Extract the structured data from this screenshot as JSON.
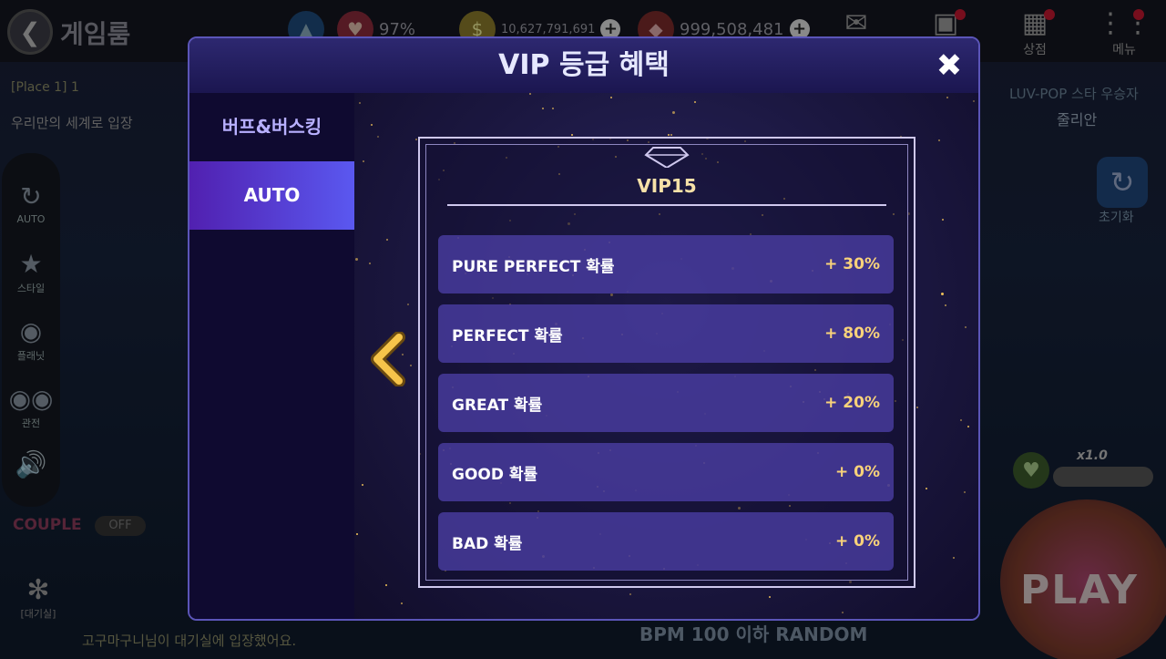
{
  "top": {
    "room_title": "게임룸",
    "stars": "",
    "heart_percent": "97%",
    "coins": "10,627,791,691",
    "gems": "999,508,481",
    "shop_label": "상점",
    "menu_label": "메뉴"
  },
  "room": {
    "place": "[Place 1] 1",
    "name": "우리만의 세계로 입장",
    "luv_pop": "LUV-POP 스타 우승자",
    "luv_pop_name": "줄리안",
    "reset_label": "초기화",
    "chat": "고구마구니님이 대기실에 입장했어요.",
    "bpm": "BPM 100 이하 RANDOM",
    "multiplier": "x1.0",
    "play": "PLAY",
    "couple": "COUPLE",
    "couple_state": "OFF",
    "waitroom": "[대기실]"
  },
  "leftbar": {
    "items": [
      "AUTO",
      "스타일",
      "플래닛",
      "관전"
    ]
  },
  "modal": {
    "title": "VIP 등급 혜택",
    "tabs": [
      "버프&버스킹",
      "AUTO"
    ],
    "active_tab": "AUTO",
    "vip_level": "VIP15",
    "rows": [
      {
        "name": "PURE PERFECT 확률",
        "value": "+ 30%"
      },
      {
        "name": "PERFECT 확률",
        "value": "+ 80%"
      },
      {
        "name": "GREAT 확률",
        "value": "+ 20%"
      },
      {
        "name": "GOOD 확률",
        "value": "+ 0%"
      },
      {
        "name": "BAD 확률",
        "value": "+ 0%"
      }
    ]
  },
  "colors": {
    "accent_tab_start": "#5120b0",
    "accent_tab_end": "#5a58f0",
    "value_gold": "#f8d27a",
    "row_bg": "#4e40aa"
  }
}
